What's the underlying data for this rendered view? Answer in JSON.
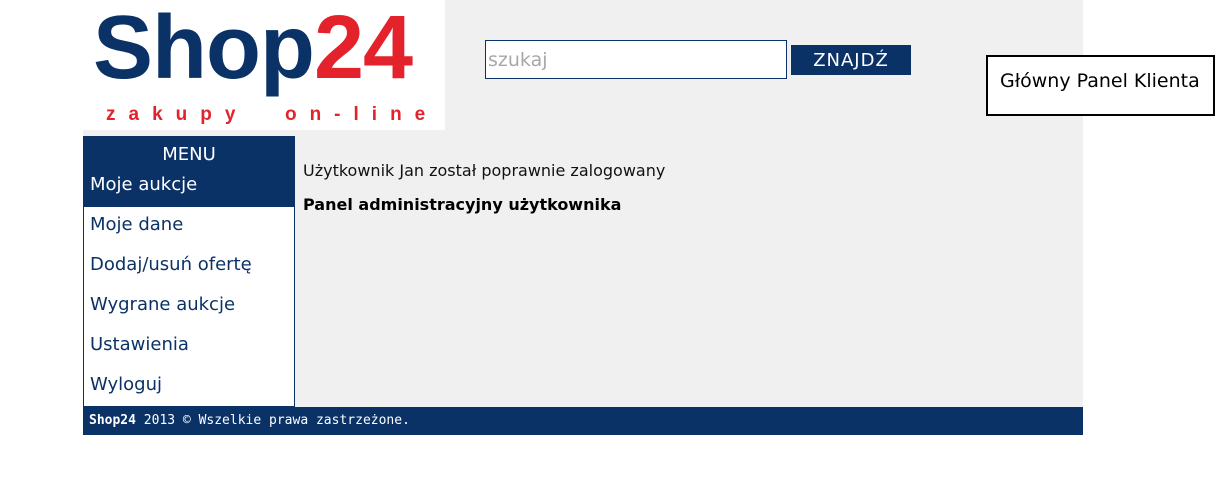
{
  "logo": {
    "brand_part1": "Shop",
    "brand_part2": "24",
    "tagline": "zakupy  on-line"
  },
  "search": {
    "value": "",
    "placeholder": "szukaj",
    "button_label": "ZNAJDŹ"
  },
  "sidebar": {
    "title": "MENU",
    "items": [
      {
        "label": "Moje aukcje"
      },
      {
        "label": "Moje dane"
      },
      {
        "label": "Dodaj/usuń ofertę"
      },
      {
        "label": "Wygrane aukcje"
      },
      {
        "label": "Ustawienia"
      },
      {
        "label": "Wyloguj"
      }
    ]
  },
  "main": {
    "login_message": "Użytkownik Jan został poprawnie zalogowany",
    "panel_title": "Panel administracyjny użytkownika"
  },
  "footer": {
    "brand": "Shop24",
    "text": " 2013 © Wszelkie prawa zastrzeżone."
  },
  "panel_label": "Główny Panel Klienta",
  "colors": {
    "brand_blue": "#0a3266",
    "brand_red": "#e4222b",
    "page_background": "#f0f0f0"
  }
}
